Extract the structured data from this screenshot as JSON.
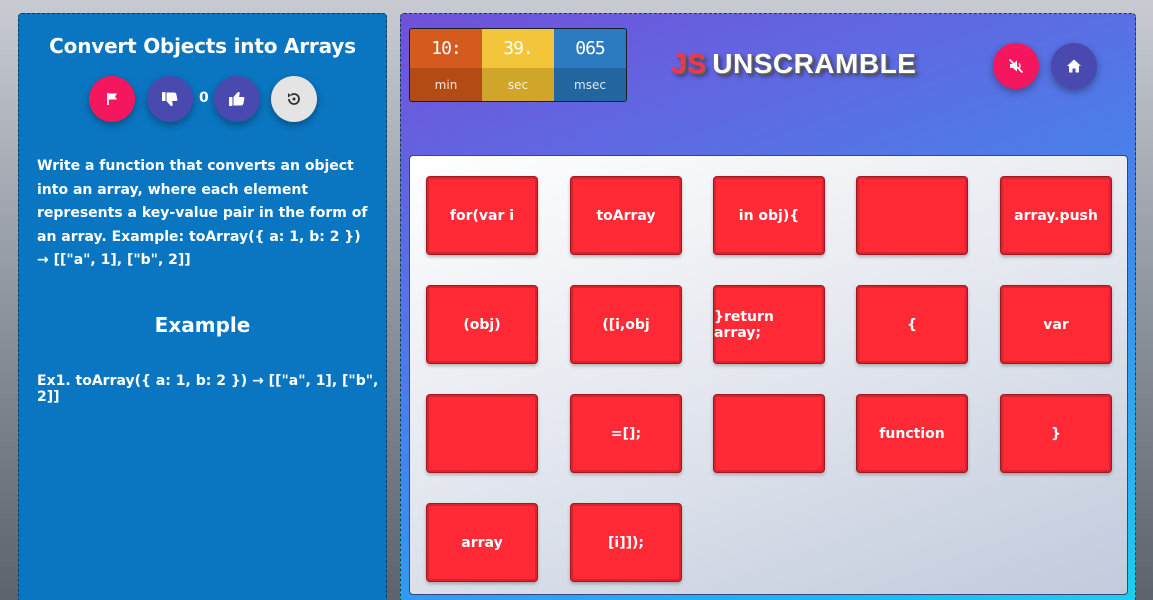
{
  "challenge": {
    "title": "Convert Objects into Arrays",
    "like_count": "0",
    "description": "Write a function that converts an object into an array, where each element represents a key-value pair in the form of an array. Example: toArray({ a: 1, b: 2 }) → [[\"a\", 1], [\"b\", 2]]",
    "example_heading": "Example",
    "example_text": "Ex1. toArray({ a: 1, b: 2 }) → [[\"a\", 1], [\"b\", 2]]"
  },
  "timer": {
    "min_value": "10:",
    "min_label": "min",
    "sec_value": "39.",
    "sec_label": "sec",
    "msec_value": "065",
    "msec_label": "msec"
  },
  "logo": {
    "js": "JS",
    "rest": "UNSCRAMBLE"
  },
  "icons": {
    "flag": "flag-icon",
    "dislike": "thumbs-down-icon",
    "like": "thumbs-up-icon",
    "reset": "reset-icon",
    "mute": "volume-mute-icon",
    "home": "home-icon"
  },
  "colors": {
    "tile": "#ff2a35",
    "accent_pink": "#f5175e",
    "accent_purple": "#4a49b0",
    "left_panel": "#0a76c2"
  },
  "tiles": [
    "for(var i",
    "toArray",
    "in obj){",
    "",
    "array.push",
    "(obj)",
    "([i,obj",
    "}return array;",
    "{",
    "var",
    "",
    "=[];",
    "",
    "function",
    "}",
    "array",
    "[i]]);"
  ]
}
